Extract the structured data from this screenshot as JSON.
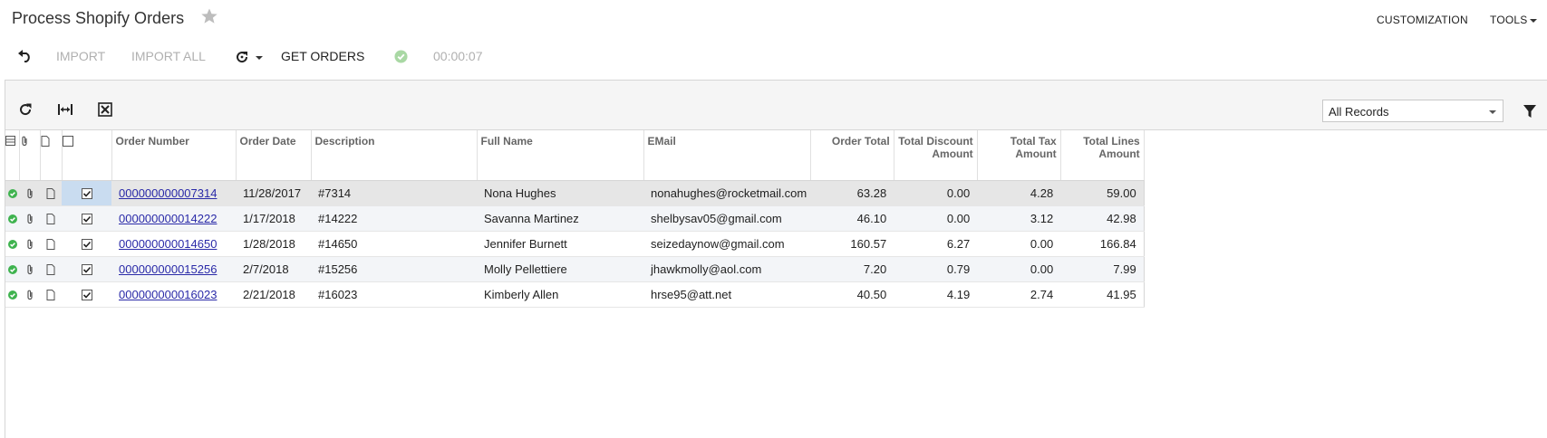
{
  "header": {
    "title": "Process Shopify Orders",
    "customization_label": "CUSTOMIZATION",
    "tools_label": "TOOLS"
  },
  "toolbar": {
    "import_label": "IMPORT",
    "import_all_label": "IMPORT ALL",
    "get_orders_label": "GET ORDERS",
    "elapsed_time": "00:00:07"
  },
  "filter": {
    "selected": "All Records"
  },
  "table": {
    "columns": {
      "order_number": "Order Number",
      "order_date": "Order Date",
      "description": "Description",
      "full_name": "Full Name",
      "email": "EMail",
      "order_total": "Order Total",
      "total_discount": "Total Discount Amount",
      "total_tax": "Total Tax Amount",
      "total_lines": "Total Lines Amount"
    },
    "rows": [
      {
        "order_number": "000000000007314",
        "order_date": "11/28/2017",
        "description": "#7314",
        "full_name": "Nona Hughes",
        "email": "nonahughes@rocketmail.com",
        "order_total": "63.28",
        "total_discount": "0.00",
        "total_tax": "4.28",
        "total_lines": "59.00"
      },
      {
        "order_number": "000000000014222",
        "order_date": "1/17/2018",
        "description": "#14222",
        "full_name": "Savanna Martinez",
        "email": "shelbysav05@gmail.com",
        "order_total": "46.10",
        "total_discount": "0.00",
        "total_tax": "3.12",
        "total_lines": "42.98"
      },
      {
        "order_number": "000000000014650",
        "order_date": "1/28/2018",
        "description": "#14650",
        "full_name": "Jennifer Burnett",
        "email": "seizedaynow@gmail.com",
        "order_total": "160.57",
        "total_discount": "6.27",
        "total_tax": "0.00",
        "total_lines": "166.84"
      },
      {
        "order_number": "000000000015256",
        "order_date": "2/7/2018",
        "description": "#15256",
        "full_name": "Molly Pellettiere",
        "email": "jhawkmolly@aol.com",
        "order_total": "7.20",
        "total_discount": "0.79",
        "total_tax": "0.00",
        "total_lines": "7.99"
      },
      {
        "order_number": "000000000016023",
        "order_date": "2/21/2018",
        "description": "#16023",
        "full_name": "Kimberly Allen",
        "email": "hrse95@att.net",
        "order_total": "40.50",
        "total_discount": "4.19",
        "total_tax": "2.74",
        "total_lines": "41.95"
      }
    ]
  },
  "icons": {
    "favorite": "star-icon",
    "undo": "undo-icon",
    "schedule": "schedule-icon",
    "status": "check-circle-icon",
    "refresh": "refresh-icon",
    "fit_columns": "fit-columns-icon",
    "export": "export-excel-icon",
    "filter": "filter-icon"
  },
  "colors": {
    "link": "#2a2aa8",
    "success": "#3fb34f",
    "disabled_text": "#b0b0b0",
    "selected_cell": "#c9dcf0"
  }
}
